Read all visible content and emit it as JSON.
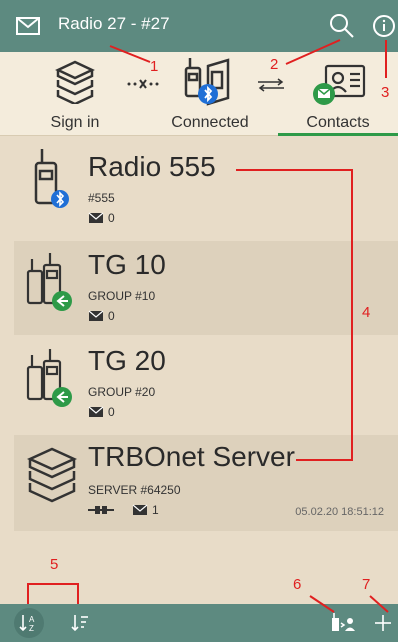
{
  "topbar": {
    "title": "Radio 27 - #27",
    "icons": [
      "mail-icon",
      "search-icon",
      "info-icon"
    ]
  },
  "tabs": [
    {
      "label": "Sign in"
    },
    {
      "label": "Connected"
    },
    {
      "label": "Contacts",
      "active": true
    }
  ],
  "contacts": [
    {
      "name": "Radio 555",
      "id": "#555",
      "messages": "0"
    },
    {
      "name": "TG 10",
      "id": "GROUP #10",
      "messages": "0"
    },
    {
      "name": "TG 20",
      "id": "GROUP #20",
      "messages": "0"
    },
    {
      "name": "TRBOnet Server",
      "id": "SERVER #64250",
      "messages": "1",
      "timestamp": "05.02.20 18:51:12"
    }
  ],
  "annotations": [
    "1",
    "2",
    "3",
    "4",
    "5",
    "6",
    "7"
  ],
  "colors": {
    "bar": "#5d8a80",
    "accent": "#2e9a48",
    "annotation": "#e02020",
    "bluetooth": "#1f6fd6"
  }
}
